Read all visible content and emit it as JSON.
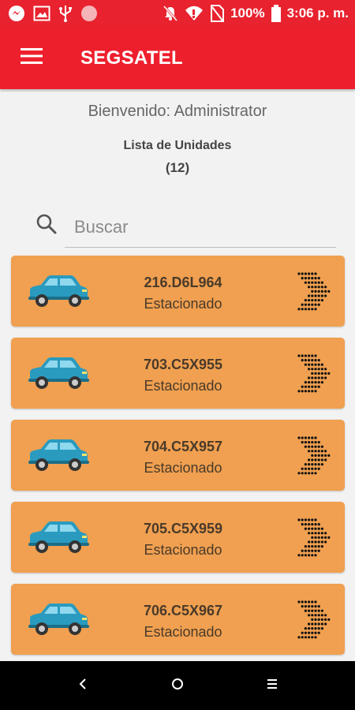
{
  "status_bar": {
    "battery": "100%",
    "time": "3:06 p. m.",
    "icons": [
      "messenger-icon",
      "image-icon",
      "usb-icon",
      "record-icon",
      "mute-icon",
      "wifi-icon",
      "no-sim-icon",
      "battery-icon"
    ]
  },
  "app_bar": {
    "title": "SEGSATEL",
    "menu_icon": "hamburger-menu-icon"
  },
  "welcome": "Bienvenido: Administrator",
  "list": {
    "title": "Lista de Unidades",
    "count": "(12)"
  },
  "search": {
    "placeholder": "Buscar",
    "value": ""
  },
  "colors": {
    "status_bar": "#e8222e",
    "app_bar": "#ee1f2d",
    "card": "#f0a050",
    "car": "#2a9bbf"
  },
  "units": [
    {
      "plate": "216.D6L964",
      "status": "Estacionado"
    },
    {
      "plate": "703.C5X955",
      "status": "Estacionado"
    },
    {
      "plate": "704.C5X957",
      "status": "Estacionado"
    },
    {
      "plate": "705.C5X959",
      "status": "Estacionado"
    },
    {
      "plate": "706.C5X967",
      "status": "Estacionado"
    }
  ],
  "nav_bar": {
    "icons": [
      "back-icon",
      "home-icon",
      "recents-icon"
    ]
  }
}
